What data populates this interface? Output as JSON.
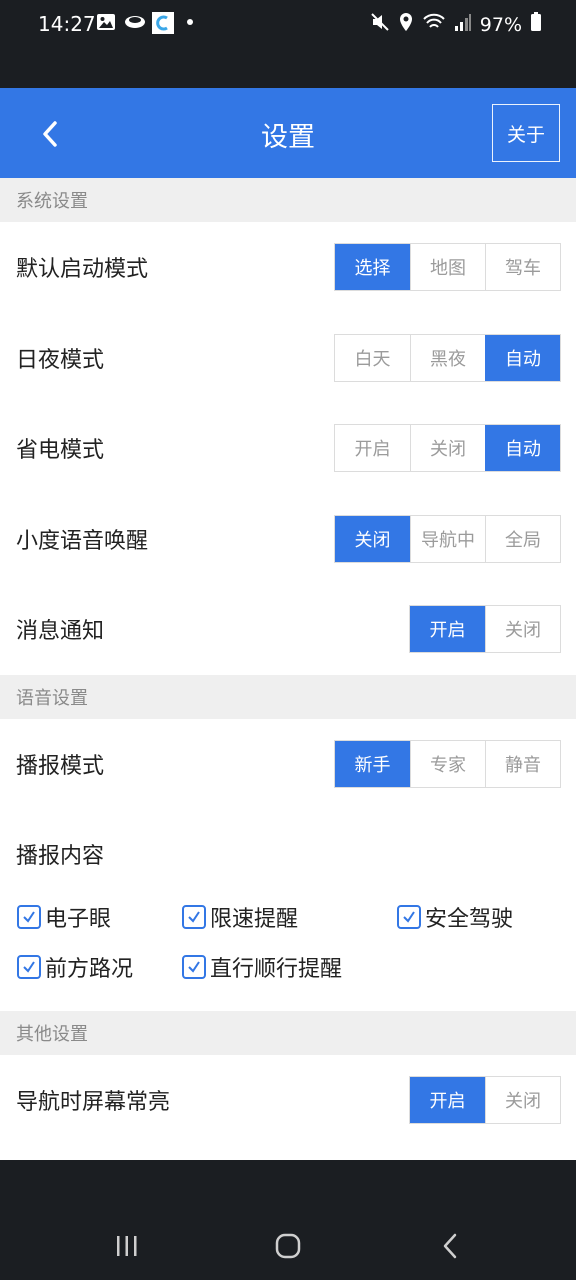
{
  "status_bar": {
    "time": "14:27",
    "battery": "97%",
    "left_icons": [
      "image-icon",
      "cloud-icon",
      "app-icon",
      "dot-icon"
    ],
    "right_icons": [
      "mute-icon",
      "location-icon",
      "wifi-icon",
      "signal-icon",
      "battery-icon"
    ]
  },
  "header": {
    "title": "设置",
    "about_label": "关于"
  },
  "sections": {
    "system": {
      "title": "系统设置",
      "rows": [
        {
          "label": "默认启动模式",
          "options": [
            "选择",
            "地图",
            "驾车"
          ],
          "selected": 0
        },
        {
          "label": "日夜模式",
          "options": [
            "白天",
            "黑夜",
            "自动"
          ],
          "selected": 2
        },
        {
          "label": "省电模式",
          "options": [
            "开启",
            "关闭",
            "自动"
          ],
          "selected": 2
        },
        {
          "label": "小度语音唤醒",
          "options": [
            "关闭",
            "导航中",
            "全局"
          ],
          "selected": 0
        },
        {
          "label": "消息通知",
          "options": [
            "开启",
            "关闭"
          ],
          "selected": 0
        }
      ]
    },
    "voice": {
      "title": "语音设置",
      "broadcast_mode": {
        "label": "播报模式",
        "options": [
          "新手",
          "专家",
          "静音"
        ],
        "selected": 0
      },
      "broadcast_content": {
        "label": "播报内容",
        "items": [
          {
            "label": "电子眼",
            "checked": true
          },
          {
            "label": "限速提醒",
            "checked": true
          },
          {
            "label": "安全驾驶",
            "checked": true
          },
          {
            "label": "前方路况",
            "checked": true
          },
          {
            "label": "直行顺行提醒",
            "checked": true
          }
        ]
      }
    },
    "other": {
      "title": "其他设置",
      "rows": [
        {
          "label": "导航时屏幕常亮",
          "options": [
            "开启",
            "关闭"
          ],
          "selected": 0
        }
      ]
    }
  },
  "colors": {
    "accent": "#3377e5",
    "section_bg": "#efefef",
    "system_bar": "#1b1e22"
  },
  "nav_bar": {
    "buttons": [
      "recent-apps-icon",
      "home-icon",
      "back-icon"
    ]
  }
}
